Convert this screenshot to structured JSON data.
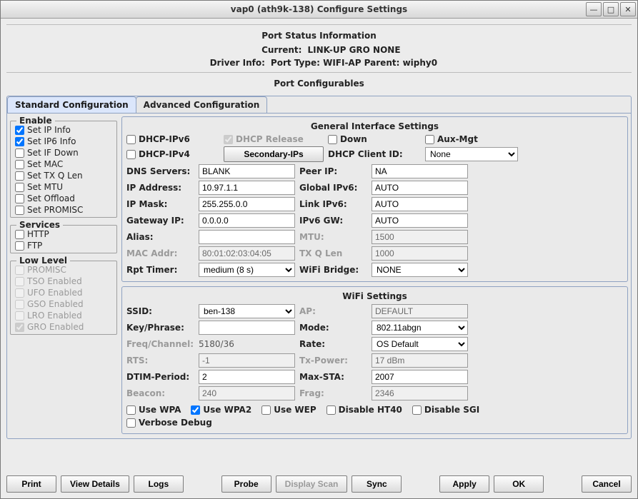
{
  "window": {
    "title": "vap0  (ath9k-138) Configure Settings"
  },
  "port_status": {
    "heading": "Port Status Information",
    "current_label": "Current:",
    "current_value": "LINK-UP GRO  NONE",
    "driver_label": "Driver Info:",
    "driver_value": "Port Type: WIFI-AP   Parent: wiphy0"
  },
  "port_conf_heading": "Port Configurables",
  "tabs": {
    "std": "Standard Configuration",
    "adv": "Advanced Configuration"
  },
  "enable": {
    "legend": "Enable",
    "items": [
      {
        "label": "Set IP Info",
        "checked": true
      },
      {
        "label": "Set IP6 Info",
        "checked": true
      },
      {
        "label": "Set IF Down",
        "checked": false
      },
      {
        "label": "Set MAC",
        "checked": false
      },
      {
        "label": "Set TX Q Len",
        "checked": false
      },
      {
        "label": "Set MTU",
        "checked": false
      },
      {
        "label": "Set Offload",
        "checked": false
      },
      {
        "label": "Set PROMISC",
        "checked": false
      }
    ]
  },
  "services": {
    "legend": "Services",
    "items": [
      {
        "label": "HTTP",
        "checked": false
      },
      {
        "label": "FTP",
        "checked": false
      }
    ]
  },
  "lowlevel": {
    "legend": "Low Level",
    "items": [
      {
        "label": "PROMISC",
        "checked": false
      },
      {
        "label": "TSO Enabled",
        "checked": false
      },
      {
        "label": "UFO Enabled",
        "checked": false
      },
      {
        "label": "GSO Enabled",
        "checked": false
      },
      {
        "label": "LRO Enabled",
        "checked": false
      },
      {
        "label": "GRO Enabled",
        "checked": true
      }
    ]
  },
  "general": {
    "heading": "General Interface Settings",
    "dhcp_ipv6": "DHCP-IPv6",
    "dhcp_release": "DHCP Release",
    "down": "Down",
    "aux_mgt": "Aux-Mgt",
    "dhcp_ipv4": "DHCP-IPv4",
    "secondary_ips_btn": "Secondary-IPs",
    "dhcp_client_id_lbl": "DHCP Client ID:",
    "dhcp_client_id_val": "None",
    "dns_lbl": "DNS Servers:",
    "dns_val": "BLANK",
    "peer_lbl": "Peer IP:",
    "peer_val": "NA",
    "ip_lbl": "IP Address:",
    "ip_val": "10.97.1.1",
    "gip6_lbl": "Global IPv6:",
    "gip6_val": "AUTO",
    "mask_lbl": "IP Mask:",
    "mask_val": "255.255.0.0",
    "lip6_lbl": "Link IPv6:",
    "lip6_val": "AUTO",
    "gw_lbl": "Gateway IP:",
    "gw_val": "0.0.0.0",
    "ip6gw_lbl": "IPv6 GW:",
    "ip6gw_val": "AUTO",
    "alias_lbl": "Alias:",
    "alias_val": "",
    "mtu_lbl": "MTU:",
    "mtu_val": "1500",
    "mac_lbl": "MAC Addr:",
    "mac_val": "80:01:02:03:04:05",
    "txq_lbl": "TX Q Len",
    "txq_val": "1000",
    "rpt_lbl": "Rpt Timer:",
    "rpt_val": "medium  (8 s)",
    "bridge_lbl": "WiFi Bridge:",
    "bridge_val": "NONE"
  },
  "wifi": {
    "heading": "WiFi Settings",
    "ssid_lbl": "SSID:",
    "ssid_val": "ben-138",
    "ap_lbl": "AP:",
    "ap_val": "DEFAULT",
    "key_lbl": "Key/Phrase:",
    "key_val": "",
    "mode_lbl": "Mode:",
    "mode_val": "802.11abgn",
    "freq_lbl": "Freq/Channel:",
    "freq_val": "5180/36",
    "rate_lbl": "Rate:",
    "rate_val": "OS Default",
    "rts_lbl": "RTS:",
    "rts_val": "-1",
    "txp_lbl": "Tx-Power:",
    "txp_val": "17 dBm",
    "dtim_lbl": "DTIM-Period:",
    "dtim_val": "2",
    "maxsta_lbl": "Max-STA:",
    "maxsta_val": "2007",
    "beacon_lbl": "Beacon:",
    "beacon_val": "240",
    "frag_lbl": "Frag:",
    "frag_val": "2346",
    "use_wpa": "Use WPA",
    "use_wpa2": "Use WPA2",
    "use_wep": "Use WEP",
    "dis_ht40": "Disable HT40",
    "dis_sgi": "Disable SGI",
    "verbose": "Verbose Debug"
  },
  "footer": {
    "print": "Print",
    "view": "View Details",
    "logs": "Logs",
    "probe": "Probe",
    "dscan": "Display Scan",
    "sync": "Sync",
    "apply": "Apply",
    "ok": "OK",
    "cancel": "Cancel"
  }
}
